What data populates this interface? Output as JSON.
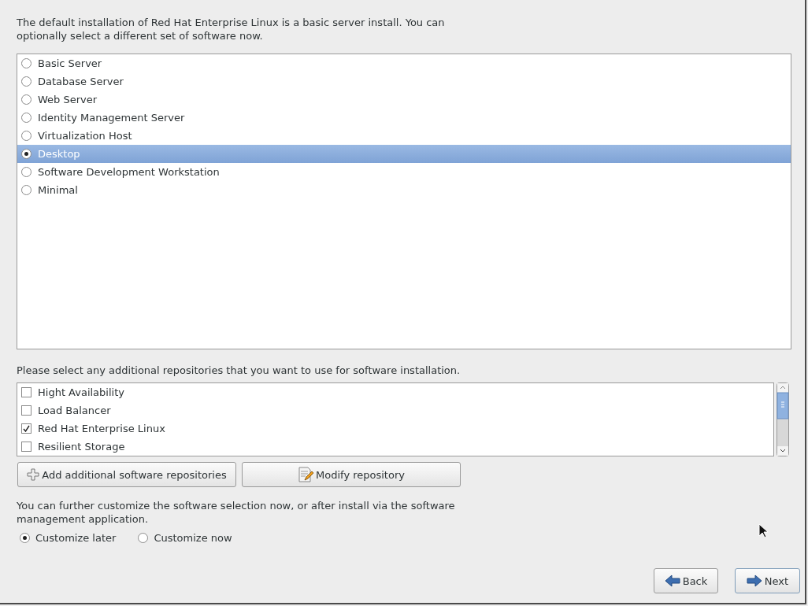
{
  "intro": "The default installation of Red Hat Enterprise Linux is a basic server install. You can optionally select a different set of software now.",
  "software_sets": [
    {
      "label": "Basic Server",
      "selected": false
    },
    {
      "label": "Database Server",
      "selected": false
    },
    {
      "label": "Web Server",
      "selected": false
    },
    {
      "label": "Identity Management Server",
      "selected": false
    },
    {
      "label": "Virtualization Host",
      "selected": false
    },
    {
      "label": "Desktop",
      "selected": true
    },
    {
      "label": "Software Development Workstation",
      "selected": false
    },
    {
      "label": "Minimal",
      "selected": false
    }
  ],
  "repositories_label": "Please select any additional repositories that you want to use for software installation.",
  "repositories": [
    {
      "label": "Hight Availability",
      "checked": false
    },
    {
      "label": "Load Balancer",
      "checked": false
    },
    {
      "label": "Red Hat Enterprise Linux",
      "checked": true
    },
    {
      "label": "Resilient Storage",
      "checked": false
    }
  ],
  "repo_buttons": [
    {
      "kind": "add",
      "label": "Add additional software repositories"
    },
    {
      "kind": "modify",
      "label": "Modify repository"
    }
  ],
  "customize_text": "You can further customize the software selection now, or after install via the software management application.",
  "customize_options": [
    {
      "label": "Customize later",
      "selected": true
    },
    {
      "label": "Customize now",
      "selected": false
    }
  ],
  "nav_buttons": [
    {
      "kind": "back",
      "label": "Back"
    },
    {
      "kind": "next",
      "label": "Next"
    }
  ]
}
